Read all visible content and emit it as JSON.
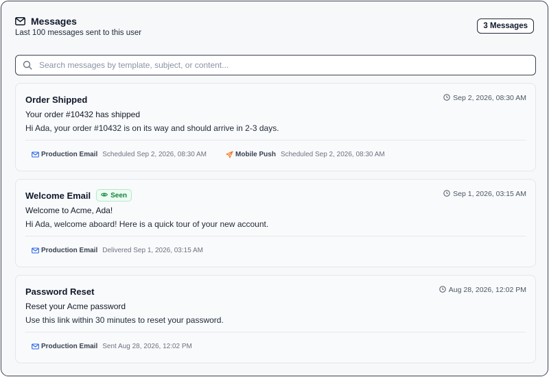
{
  "header": {
    "icon": "mail-icon",
    "title": "Messages",
    "subtitle": "Last 100 messages sent to this user",
    "count_badge": "3 Messages"
  },
  "search": {
    "icon": "search-icon",
    "placeholder": "Search messages by template, subject, or content...",
    "value": ""
  },
  "messages": [
    {
      "title": "Order Shipped",
      "badge": "",
      "time": "Sep 2, 2026, 08:30 AM",
      "subject": "Your order #10432 has shipped",
      "body": "Hi Ada, your order #10432 is on its way and should arrive in 2-3 days.",
      "channels": [
        {
          "icon": "mail-icon",
          "name": "Production Email",
          "status": "Scheduled Sep 2, 2026, 08:30 AM"
        },
        {
          "icon": "send-icon",
          "name": "Mobile Push",
          "status": "Scheduled Sep 2, 2026, 08:30 AM"
        }
      ]
    },
    {
      "title": "Welcome Email",
      "badge": "Seen",
      "time": "Sep 1, 2026, 03:15 AM",
      "subject": "Welcome to Acme, Ada!",
      "body": "Hi Ada, welcome aboard! Here is a quick tour of your new account.",
      "channels": [
        {
          "icon": "mail-icon",
          "name": "Production Email",
          "status": "Delivered Sep 1, 2026, 03:15 AM"
        }
      ]
    },
    {
      "title": "Password Reset",
      "badge": "",
      "time": "Aug 28, 2026, 12:02 PM",
      "subject": "Reset your Acme password",
      "body": "Use this link within 30 minutes to reset your password.",
      "channels": [
        {
          "icon": "mail-icon",
          "name": "Production Email",
          "status": "Sent Aug 28, 2026, 12:02 PM"
        }
      ]
    }
  ],
  "colors": {
    "seen_badge_bg": "#ecfdf3",
    "seen_badge_text": "#15803d",
    "mail_icon": "#2563eb",
    "push_icon": "#f97316",
    "border": "#3b4150"
  }
}
